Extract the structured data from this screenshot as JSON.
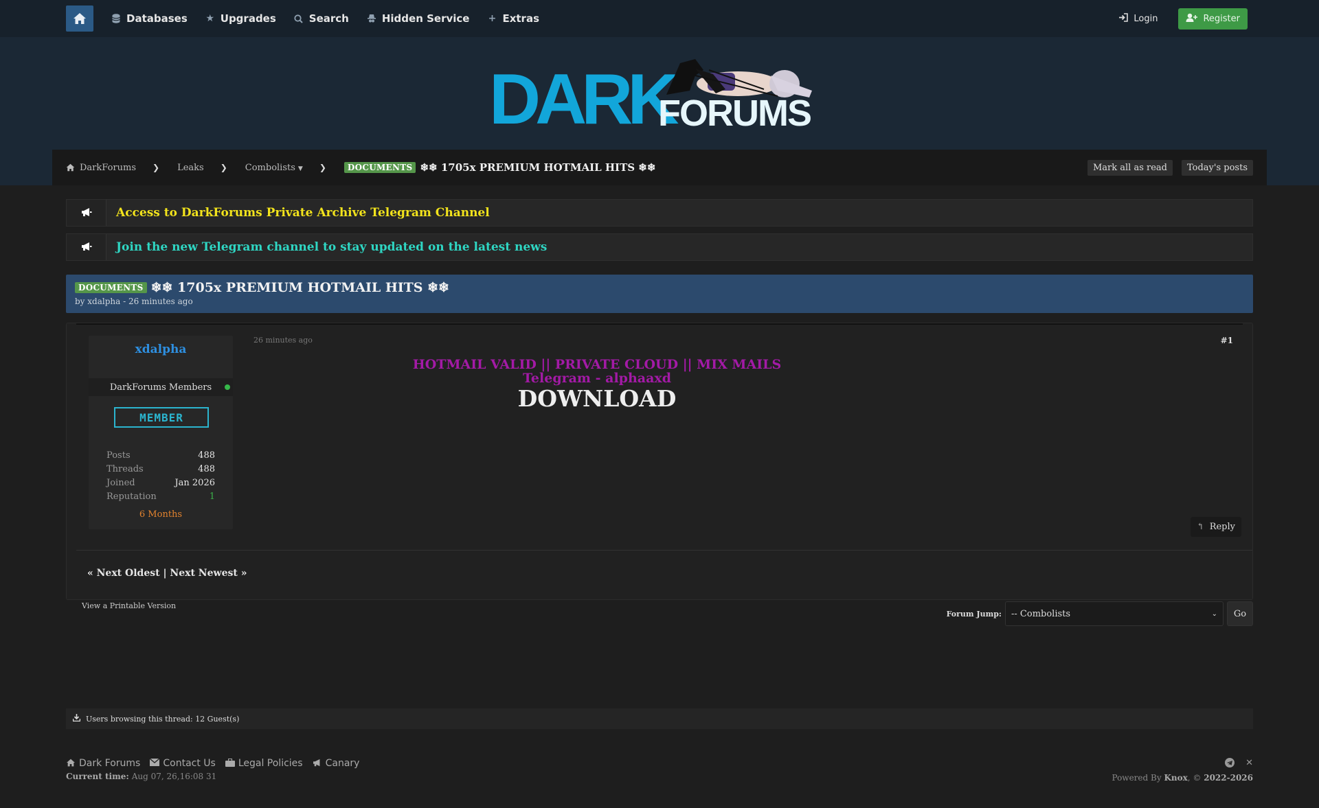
{
  "nav": {
    "items": [
      {
        "label": "Databases",
        "icon": "database-icon"
      },
      {
        "label": "Upgrades",
        "icon": "star-icon"
      },
      {
        "label": "Search",
        "icon": "search-icon"
      },
      {
        "label": "Hidden Service",
        "icon": "hat-icon"
      },
      {
        "label": "Extras",
        "icon": "plus-icon"
      }
    ],
    "login": "Login",
    "register": "Register"
  },
  "logo": {
    "dark": "DARK",
    "forums": "FORUMS"
  },
  "breadcrumb": {
    "home": "DarkForums",
    "leaks": "Leaks",
    "combolists": "Combolists",
    "badge": "DOCUMENTS",
    "title": "❄❄ 1705x PREMIUM HOTMAIL HITS ❄❄",
    "mark_read": "Mark all as read",
    "todays_posts": "Today's posts"
  },
  "announcements": [
    {
      "text": "Access to DarkForums Private Archive Telegram Channel",
      "color": "#f2e31c"
    },
    {
      "text": "Join the new Telegram channel to stay updated on the latest news",
      "color": "#2fd6c3"
    }
  ],
  "thread": {
    "badge": "DOCUMENTS",
    "title": "❄❄ 1705x PREMIUM HOTMAIL HITS ❄❄",
    "byline": "by xdalpha - 26 minutes ago"
  },
  "post": {
    "username": "xdalpha",
    "usergroup": "DarkForums Members",
    "rank": "MEMBER",
    "stats": {
      "posts_label": "Posts",
      "posts": "488",
      "threads_label": "Threads",
      "threads": "488",
      "joined_label": "Joined",
      "joined": "Jan 2026",
      "reputation_label": "Reputation",
      "reputation": "1"
    },
    "months": "6 Months",
    "date": "26 minutes ago",
    "number": "#1",
    "body_line1": "HOTMAIL VALID || PRIVATE CLOUD || MIX MAILS",
    "body_line2": "Telegram - alphaaxd",
    "body_line3": "DOWNLOAD",
    "reply": "Reply",
    "pager": "« Next Oldest | Next Newest »"
  },
  "printable": "View a Printable Version",
  "forum_jump": {
    "label": "Forum Jump:",
    "selected": "-- Combolists",
    "go": "Go"
  },
  "browsing": "Users browsing this thread: 12 Guest(s)",
  "footer": {
    "links": [
      "Dark Forums",
      "Contact Us",
      "Legal Policies",
      "Canary"
    ],
    "time_label": "Current time:",
    "time_value": "Aug 07, 26,16:08 31",
    "powered_prefix": "Powered By",
    "powered_brand": "Knox",
    "powered_suffix": ", ©",
    "years": "2022-2026"
  }
}
